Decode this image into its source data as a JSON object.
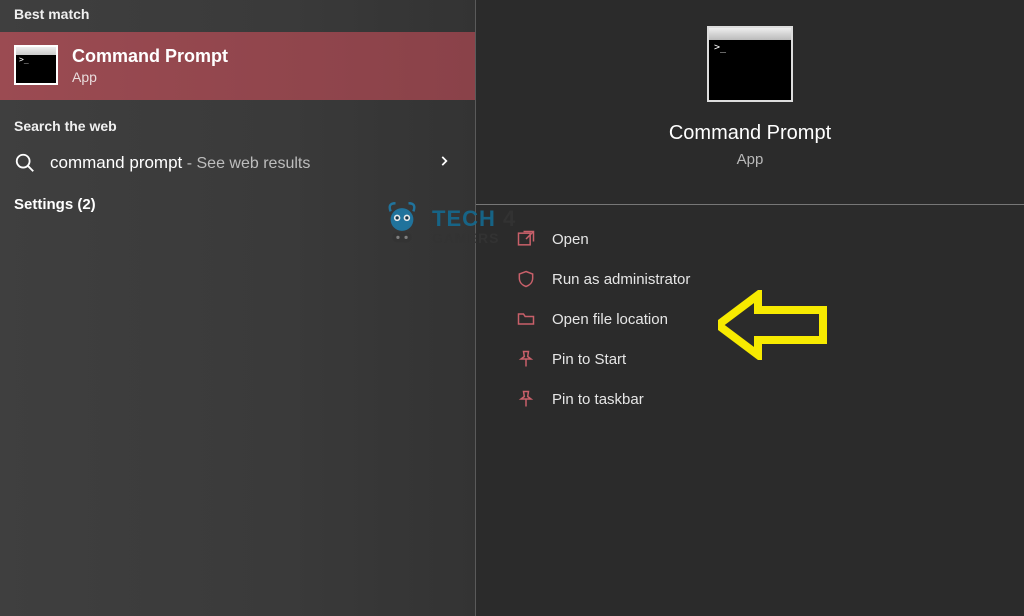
{
  "left": {
    "best_match_header": "Best match",
    "best_match": {
      "title": "Command Prompt",
      "subtitle": "App"
    },
    "search_web_header": "Search the web",
    "web_result": {
      "query": "command prompt",
      "suffix": " - See web results"
    },
    "settings_header": "Settings (2)"
  },
  "right": {
    "title": "Command Prompt",
    "subtitle": "App",
    "actions": [
      {
        "label": "Open",
        "icon": "open-icon"
      },
      {
        "label": "Run as administrator",
        "icon": "shield-icon"
      },
      {
        "label": "Open file location",
        "icon": "folder-icon"
      },
      {
        "label": "Pin to Start",
        "icon": "pin-start-icon"
      },
      {
        "label": "Pin to taskbar",
        "icon": "pin-taskbar-icon"
      }
    ]
  },
  "watermark": {
    "line1a": "TECH",
    "line1b": "4",
    "line2": "GAMERS"
  },
  "colors": {
    "accent": "#9b4b52",
    "action_icon": "#c9606a",
    "annotation": "#f7ea00"
  }
}
